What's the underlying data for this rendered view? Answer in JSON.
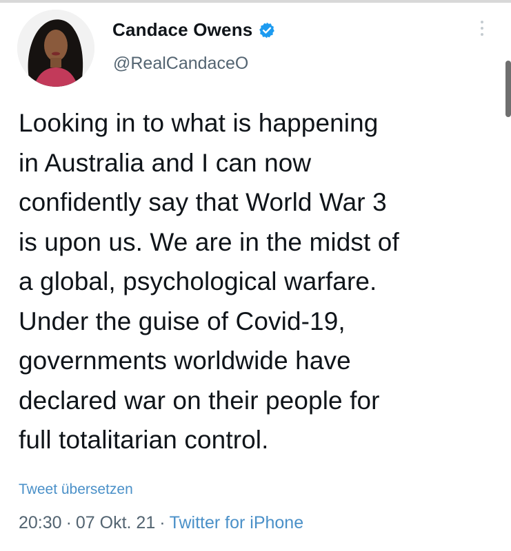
{
  "tweet": {
    "author": {
      "display_name": "Candace Owens",
      "handle": "@RealCandaceO",
      "verified": true,
      "verified_icon": "verified-badge-icon",
      "avatar": "profile-photo"
    },
    "text_lines": [
      "Looking in to what is happening",
      "in Australia and I can now",
      "confidently say that World War 3",
      "is upon us. We are in the midst of",
      "a global, psychological warfare.",
      "Under the guise of Covid-19,",
      "governments worldwide have",
      "declared war on their people for",
      "full totalitarian control."
    ],
    "translate_label": "Tweet übersetzen",
    "time": "20:30",
    "date": "07 Okt. 21",
    "separator": "·",
    "source": "Twitter for iPhone"
  },
  "colors": {
    "text": "#0f1419",
    "secondary": "#536471",
    "link": "#4a90c8",
    "verified": "#1d9bf0"
  }
}
